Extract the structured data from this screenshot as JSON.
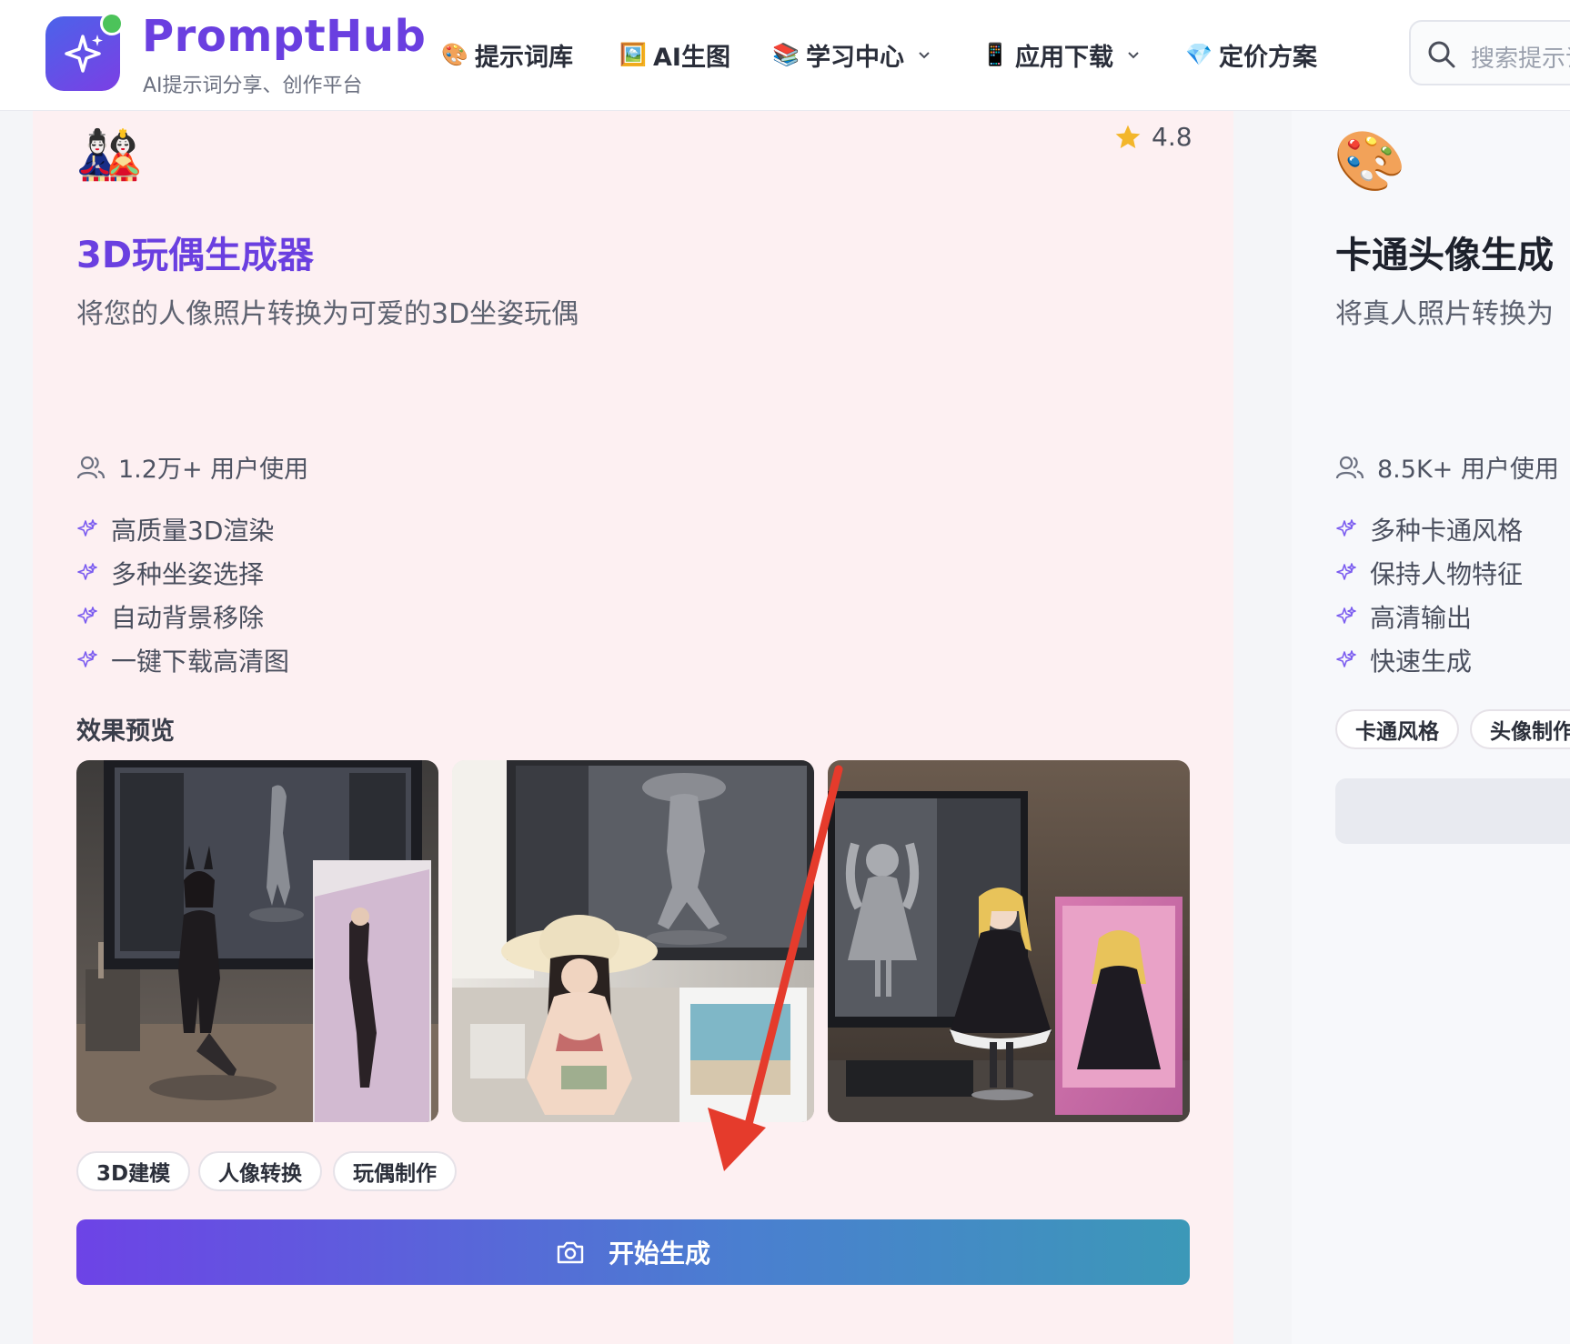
{
  "header": {
    "brand_name": "PromptHub",
    "brand_subtitle": "AI提示词分享、创作平台",
    "nav": [
      {
        "label": "提示词库",
        "icon": "palette-icon",
        "emoji": "🎨"
      },
      {
        "label": "AI生图",
        "icon": "picture-icon",
        "emoji": "🖼️"
      },
      {
        "label": "学习中心",
        "icon": "books-icon",
        "emoji": "📚",
        "has_dropdown": true
      },
      {
        "label": "应用下载",
        "icon": "phone-icon",
        "emoji": "📱",
        "has_dropdown": true
      },
      {
        "label": "定价方案",
        "icon": "diamond-icon",
        "emoji": "💎"
      }
    ],
    "search_placeholder": "搜索提示词"
  },
  "card_left": {
    "emoji": "🎎",
    "rating": "4.8",
    "title": "3D玩偶生成器",
    "description": "将您的人像照片转换为可爱的3D坐姿玩偶",
    "users": "1.2万+ 用户使用",
    "features": [
      "高质量3D渲染",
      "多种坐姿选择",
      "自动背景移除",
      "一键下载高清图"
    ],
    "preview_label": "效果预览",
    "tags": [
      "3D建模",
      "人像转换",
      "玩偶制作"
    ],
    "button_label": "开始生成"
  },
  "card_right": {
    "emoji": "🎨",
    "title": "卡通头像生成",
    "description": "将真人照片转换为",
    "users": "8.5K+ 用户使用",
    "features": [
      "多种卡通风格",
      "保持人物特征",
      "高清输出",
      "快速生成"
    ],
    "tags": [
      "卡通风格",
      "头像制作"
    ]
  },
  "colors": {
    "brand": "#6a3fe0",
    "accent_green": "#4cc35a",
    "star": "#f3b62b",
    "sparkle": "#7b5cf0",
    "arrow": "#e53b2c"
  }
}
